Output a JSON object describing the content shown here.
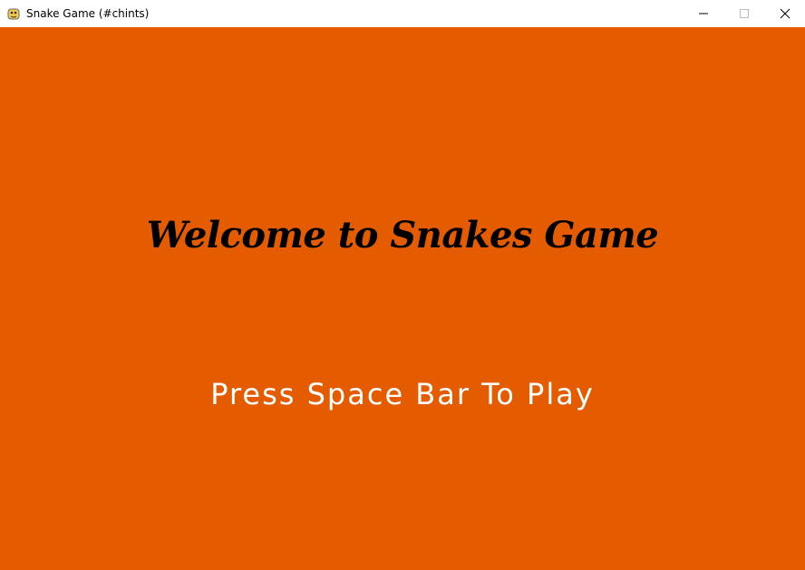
{
  "window": {
    "title": "Snake Game (#chints)",
    "icon": "pygame-snake-icon"
  },
  "controls": {
    "minimize": "minimize-icon",
    "maximize": "maximize-icon",
    "close": "close-icon"
  },
  "game": {
    "welcome_text": "Welcome to Snakes Game",
    "prompt_text": "Press Space Bar To Play"
  },
  "colors": {
    "background": "#E55C00",
    "welcome_text": "#000000",
    "prompt_text": "#FFFFFF"
  }
}
